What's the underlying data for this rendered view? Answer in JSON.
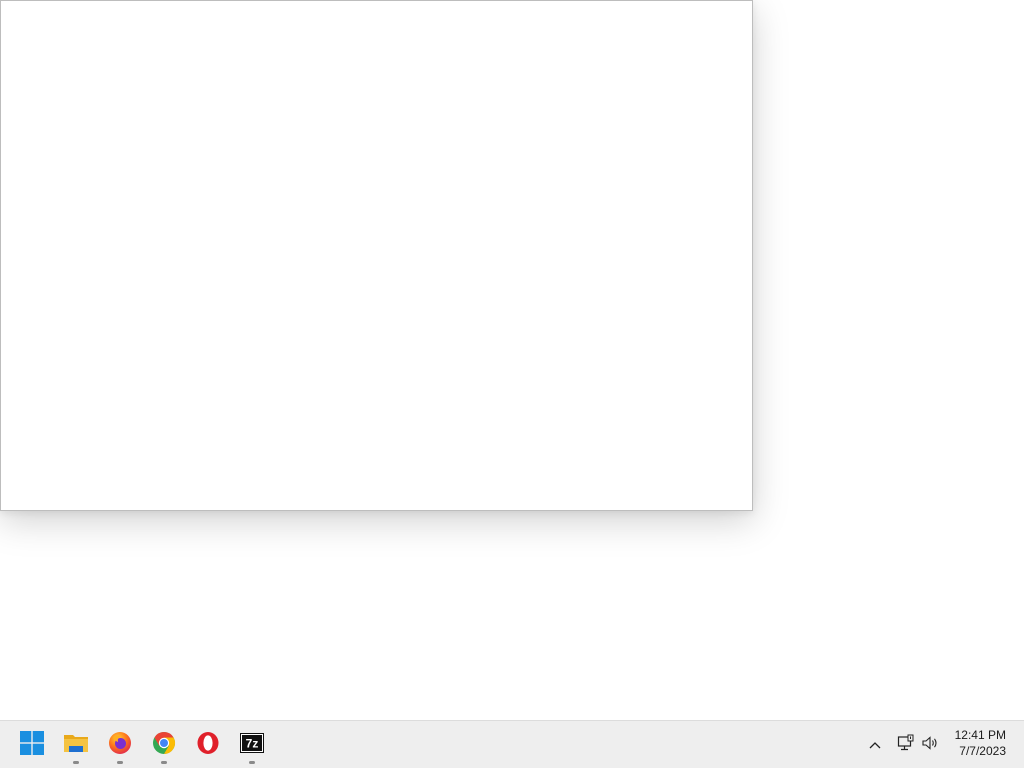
{
  "taskbar": {
    "pinned": [
      {
        "name": "start",
        "icon": "windows-logo-icon",
        "running": false
      },
      {
        "name": "file-explorer",
        "icon": "folder-icon",
        "running": true
      },
      {
        "name": "firefox",
        "icon": "firefox-icon",
        "running": true
      },
      {
        "name": "chrome",
        "icon": "chrome-icon",
        "running": true
      },
      {
        "name": "opera",
        "icon": "opera-icon",
        "running": false
      },
      {
        "name": "7zip",
        "icon": "7zip-icon",
        "running": true
      }
    ],
    "tray": {
      "overflow_icon": "chevron-up-icon",
      "network_icon": "network-icon",
      "volume_icon": "volume-icon"
    },
    "clock": {
      "time": "12:41 PM",
      "date": "7/7/2023"
    }
  },
  "colors": {
    "taskbar_bg": "#eeeeee",
    "windows_blue": "#1a8fe0",
    "folder_yellow": "#f5c342",
    "opera_red": "#e0202a"
  }
}
